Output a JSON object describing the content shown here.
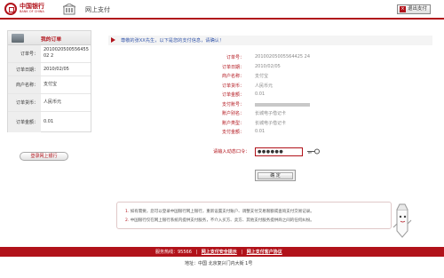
{
  "header": {
    "logo_cn": "中国银行",
    "logo_en": "BANK OF CHINA",
    "title": "网上支付",
    "exit_label": "退出支付"
  },
  "order": {
    "title": "我的订单",
    "rows": [
      {
        "label": "订单号：",
        "value": "201002050055645502 2"
      },
      {
        "label": "订单日期：",
        "value": "2010/02/05"
      },
      {
        "label": "商户名称：",
        "value": "支付宝"
      },
      {
        "label": "订单货币：",
        "value": "人民币元"
      },
      {
        "label": "订单金额：",
        "value": "0.01"
      }
    ],
    "back_label": "登录网上银行"
  },
  "notice": "尊敬的张XX先生，以下是您的支付信息，请确认！",
  "details": [
    {
      "label": "订单号：",
      "value": "20100205005564425 24"
    },
    {
      "label": "订单日期：",
      "value": "2010/02/05"
    },
    {
      "label": "商户名称：",
      "value": "支付宝"
    },
    {
      "label": "订单货币：",
      "value": "人民币元"
    },
    {
      "label": "订单金额：",
      "value": "0.01"
    },
    {
      "label": "支付账号：",
      "value": ""
    },
    {
      "label": "账户别名：",
      "value": "长城电子借记卡"
    },
    {
      "label": "账户类型：",
      "value": "长城电子借记卡"
    },
    {
      "label": "支付金额：",
      "value": "0.01"
    }
  ],
  "password": {
    "label": "请输入动态口令：",
    "value": "●●●●●●"
  },
  "confirm_label": "确 定",
  "tips": [
    {
      "num": "1.",
      "text": "如有需要，您可以登录中国银行网上银行，重新设置支付账户、调整支付交易限额或查询支付交易记录。"
    },
    {
      "num": "2.",
      "text": "中国银行仅在网上银行系统内提供支付服务，不介入买方、卖方、其他支付服务提供商之间的任何纠纷。"
    }
  ],
  "footer": {
    "hotline": "服务热线：95566",
    "link1": "网上支付安全提示",
    "link2": "网上支付客户协议",
    "address": "地址：中国 北京复兴门内大街 1号"
  },
  "colors": {
    "brand_red": "#b1121a"
  }
}
